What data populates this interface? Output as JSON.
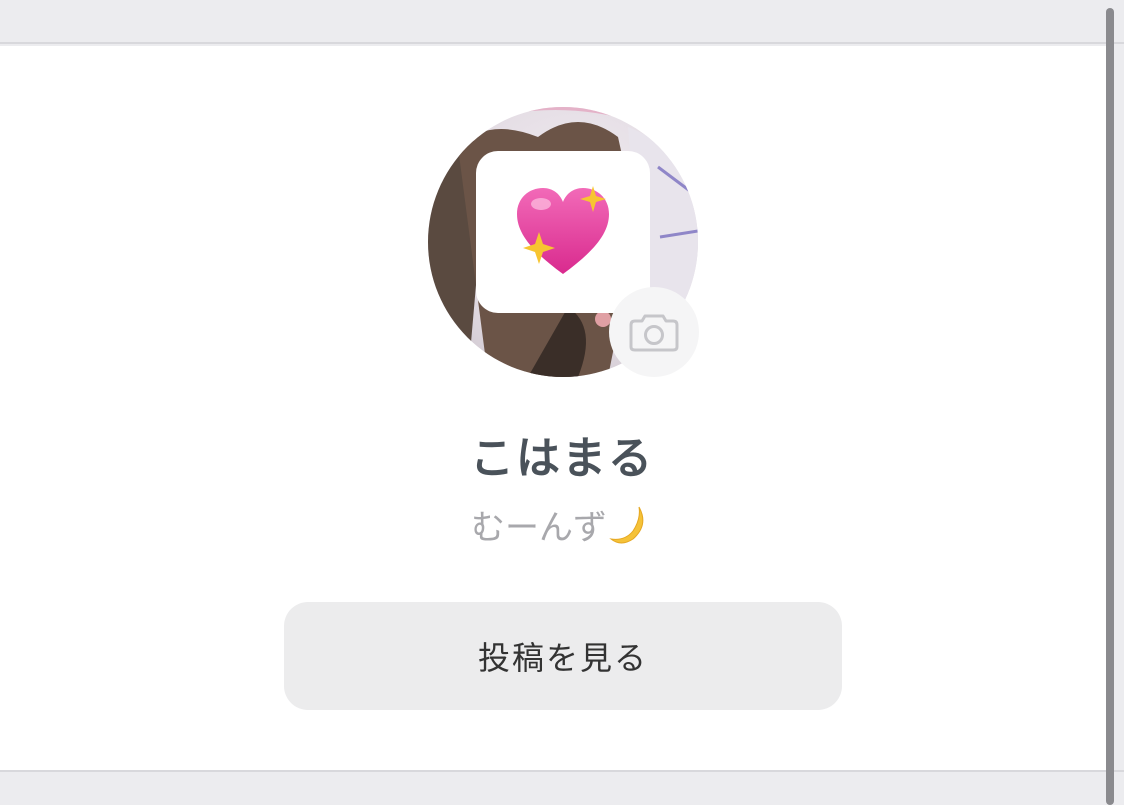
{
  "profile": {
    "name": "こはまる",
    "bio": "むーんず",
    "bio_emoji": "crescent-moon-icon",
    "avatar_icon": "sparkling-heart-icon"
  },
  "actions": {
    "change_photo_icon": "camera-icon",
    "view_posts_label": "投稿を見る"
  },
  "colors": {
    "background": "#ececef",
    "card": "#ffffff",
    "name_text": "#4a525a",
    "bio_text": "#a8a8ac",
    "button_bg": "#ececed",
    "heart": "#e0369a"
  }
}
